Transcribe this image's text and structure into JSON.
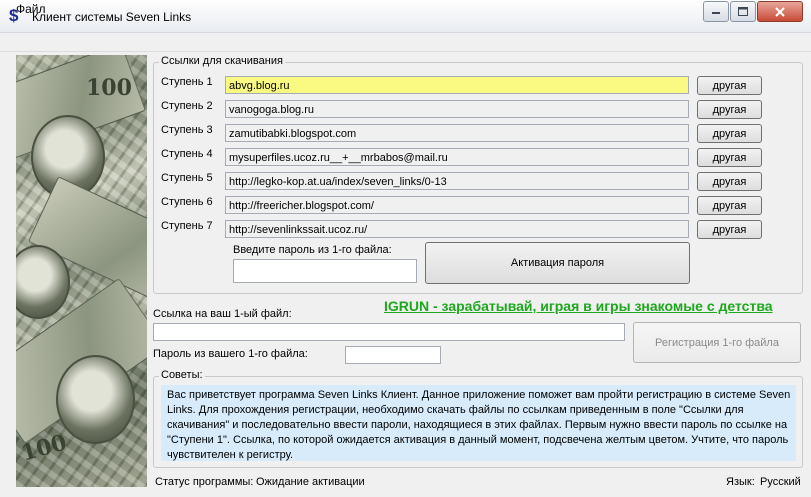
{
  "window": {
    "title": "Клиент системы Seven Links",
    "icon_char": "$"
  },
  "menu": {
    "file": "Файл"
  },
  "links_group": {
    "legend": "Ссылки для скачивания",
    "steps": [
      {
        "label": "Ступень 1",
        "url": "abvg.blog.ru",
        "button": "другая"
      },
      {
        "label": "Ступень 2",
        "url": "vanogoga.blog.ru",
        "button": "другая"
      },
      {
        "label": "Ступень 3",
        "url": "zamutibabki.blogspot.com",
        "button": "другая"
      },
      {
        "label": "Ступень 4",
        "url": "mysuperfiles.ucoz.ru__+__mrbabos@mail.ru",
        "button": "другая"
      },
      {
        "label": "Ступень 5",
        "url": "http://legko-kop.at.ua/index/seven_links/0-13",
        "button": "другая"
      },
      {
        "label": "Ступень 6",
        "url": "http://freericher.blogspot.com/",
        "button": "другая"
      },
      {
        "label": "Ступень 7",
        "url": "http://sevenlinkssait.ucoz.ru/",
        "button": "другая"
      }
    ],
    "password_label": "Введите пароль из 1-го файла:",
    "password_value": "",
    "activate_button": "Активация пароля"
  },
  "ad_link": "IGRUN - зарабатывай, играя в игры знакомые с детства",
  "registration": {
    "link_label": "Ссылка на ваш 1-ый файл:",
    "link_value": "",
    "password_label": "Пароль из вашего 1-го файла:",
    "password_value": "",
    "register_button": "Регистрация 1-го файла"
  },
  "tips": {
    "legend": "Советы:",
    "text": "Вас приветствует программа Seven Links Клиент. Данное приложение поможет вам пройти регистрацию в системе Seven Links. Для прохождения регистрации, необходимо скачать файлы по ссылкам приведенным в поле \"Ссылки для скачивания\" и последовательно ввести пароли, находящиеся в этих файлах. Первым нужно ввести пароль по ссылке на \"Ступени 1\". Ссылка, по которой ожидается активация в данный момент, подсвечена желтым цветом. Учтите, что пароль чувствителен к регистру."
  },
  "status": {
    "label": "Статус программы:",
    "value": "Ожидание активации"
  },
  "language": {
    "label": "Язык:",
    "value": "Русский"
  },
  "colors": {
    "active_field": "#fafa82",
    "tips_background": "#d7ebfb",
    "ad_link": "#1ea81e"
  }
}
